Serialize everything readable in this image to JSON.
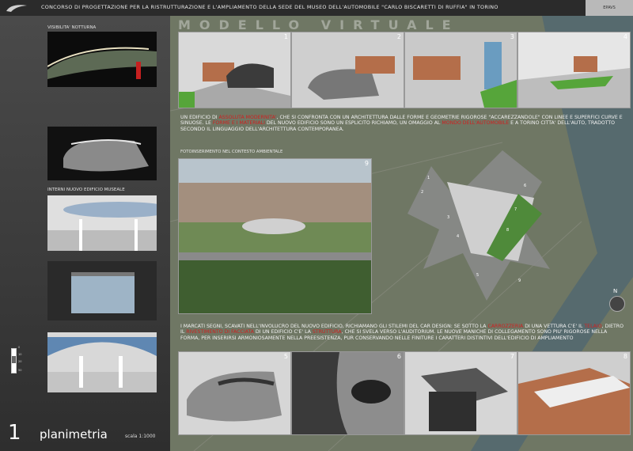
{
  "header": {
    "title": "CONCORSO  DI PROGETTAZIONE PER LA RISTRUTTURAZIONE E L'AMPLIAMENTO DELLA SEDE DEL MUSEO DELL'AUTOMOBILE \"CARLO BISCARETTI DI RUFFIA\" IN  TORINO",
    "code": "EPAVS"
  },
  "left": {
    "night_label": "VISIBILITA' NOTTURNA",
    "interiors_label": "INTERNI NUOVO EDIFICIO MUSEALE",
    "number": "1",
    "plan_title": "planimetria",
    "scale": "scala 1:1000",
    "legend": [
      "0",
      "10",
      "20",
      "50"
    ]
  },
  "main": {
    "big_title": "MODELLO VIRTUALE",
    "model_numbers": [
      "1",
      "2",
      "3",
      "4"
    ],
    "text1_parts": [
      {
        "t": "UN EDIFICIO DI ",
        "r": false
      },
      {
        "t": "ASSOLUTA MODERNITA'",
        "r": true
      },
      {
        "t": ", CHE SI CONFRONTA CON UN ARCHITETTURA DALLE FORME E GEOMETRIE RIGOROSE \"ACCAREZZANDOLE\" CON LINEE E SUPERFICI CURVE E SINUOSE. LE ",
        "r": false
      },
      {
        "t": "FORME E I MATERIALI",
        "r": true
      },
      {
        "t": " DEL NUOVO EDIFICIO SONO UN ESPLICITO RICHIAMO, UN OMAGGIO AL ",
        "r": false
      },
      {
        "t": "MONDO DELL'AUTOMOBILE",
        "r": true
      },
      {
        "t": " E A TORINO CITTA' DELL'AUTO, TRADOTTO SECONDO IL LINGUAGGIO DELL'ARCHITETTURA CONTEMPORANEA.",
        "r": false
      }
    ],
    "photo_label": "FOTOINSERIMENTO NEL CONTESTO AMBIENTALE",
    "photo_number": "9",
    "text2_parts": [
      {
        "t": "I MARCATI SEGNI, SCAVATI NELL'INVOLUCRO DEL NUOVO EDIFICIO, RICHIAMANO GLI STILEMI DEL CAR DESIGN: SE SOTTO LA ",
        "r": false
      },
      {
        "t": "CARROZZERIA",
        "r": true
      },
      {
        "t": " DI UNA VETTURA C'E' IL ",
        "r": false
      },
      {
        "t": "TELAIO",
        "r": true
      },
      {
        "t": ", DIETRO IL ",
        "r": false
      },
      {
        "t": "RIVESTIMENTO DI FACCIATA",
        "r": true
      },
      {
        "t": " DI UN EDIFICIO C'E' LA ",
        "r": false
      },
      {
        "t": "STRUTTURA",
        "r": true
      },
      {
        "t": ", CHE SI SVELA VERSO L'AUDITORIUM. LE NUOVE MANICHE DI COLLEGAMENTO SONO PIU' RIGOROSE NELLA FORMA, PER INSERIRSI ARMONIOSAMENTE NELLA PREESISTENZA, PUR CONSERVANDO NELLE FINITURE I CARATTERI DISTINTIVI DELL'EDIFICIO DI AMPLIAMENTO",
        "r": false
      }
    ],
    "detail_numbers": [
      "5",
      "6",
      "7",
      "8"
    ],
    "site_labels": [
      "1",
      "2",
      "3",
      "4",
      "5",
      "6",
      "7",
      "8",
      "9"
    ],
    "compass": "N"
  },
  "colors": {
    "accent": "#d02020",
    "panel": "#3a3a3a"
  }
}
